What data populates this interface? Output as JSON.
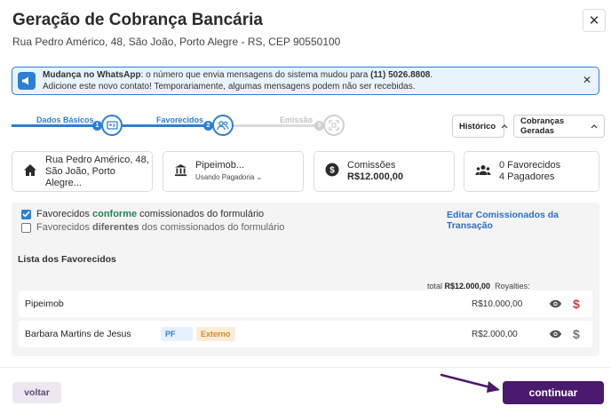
{
  "dialog": {
    "title": "Geração de Cobrança Bancária",
    "address": "Rua Pedro Américo, 48, São João, Porto Alegre - RS, CEP 90550100",
    "close_glyph": "✕"
  },
  "banner": {
    "bold_label": "Mudança no WhatsApp",
    "line1_text": ": o número que envia mensagens do sistema mudou para ",
    "phone": "(11) 5026.8808",
    "line1_end": ".",
    "line2_text": "Adicione este novo contato! Temporariamente, algumas mensagens podem não ser recebidas.",
    "close_glyph": "✕",
    "icon": "megaphone-icon"
  },
  "stepper": {
    "steps": [
      {
        "label": "Dados Básicos",
        "number": "1",
        "state": "done",
        "icon": "id-card-icon"
      },
      {
        "label": "Favorecidos",
        "number": "2",
        "state": "active",
        "icon": "users-icon"
      },
      {
        "label": "Emissão",
        "number": "3",
        "state": "pending",
        "icon": "scan-icon"
      }
    ],
    "colors": {
      "active": "#2d7fd3",
      "pending": "#cfcfcf"
    }
  },
  "dropdowns": {
    "historico": "Histórico",
    "cobrancas": "Cobranças Geradas",
    "chevron": "⌃"
  },
  "cards": {
    "property": {
      "line1": "Rua Pedro Américo, 48,",
      "line2": "São João, Porto Alegre...",
      "icon": "home-icon"
    },
    "bank": {
      "line1": "Pipeimob...",
      "line2": "Usando Pagadoria",
      "chevron": "⌄",
      "icon": "bank-icon"
    },
    "commission": {
      "line1": "Comissões",
      "line2": "R$12.000,00",
      "icon": "dollar-circle-icon"
    },
    "payees": {
      "line1": "0 Favorecidos",
      "line2": "4 Pagadores",
      "icon": "group-icon"
    }
  },
  "options": {
    "option1": {
      "pre": "Favorecidos ",
      "em": "conforme",
      "post": " comissionados do formulário",
      "checked": true
    },
    "option2": {
      "pre": "Favorecidos ",
      "em": "diferentes",
      "post": " dos comissionados do formulário",
      "checked": false
    },
    "edit_link": "Editar Comissionados da Transação"
  },
  "list": {
    "title": "Lista dos Favorecidos",
    "total_prefix": "total ",
    "total_value": "R$12.000,00",
    "royalties_label": "Royalties:",
    "rows": [
      {
        "name": "Pipeimob",
        "amount": "R$10.000,00",
        "dollar_color": "#d93b3b"
      },
      {
        "name": "Barbara Martins de Jesus",
        "type_tag": "PF",
        "origin_tag": "Externo",
        "amount": "R$2.000,00",
        "dollar_color": "#777777"
      }
    ]
  },
  "footer": {
    "back_label": "voltar",
    "continue_label": "continuar"
  },
  "colors": {
    "primary": "#2d7fd3",
    "continue_bg": "#4a1a6e",
    "arrow": "#4a1a6e",
    "tag_pf_bg": "#e6f1fc",
    "tag_externo_bg": "#fdecd6"
  }
}
